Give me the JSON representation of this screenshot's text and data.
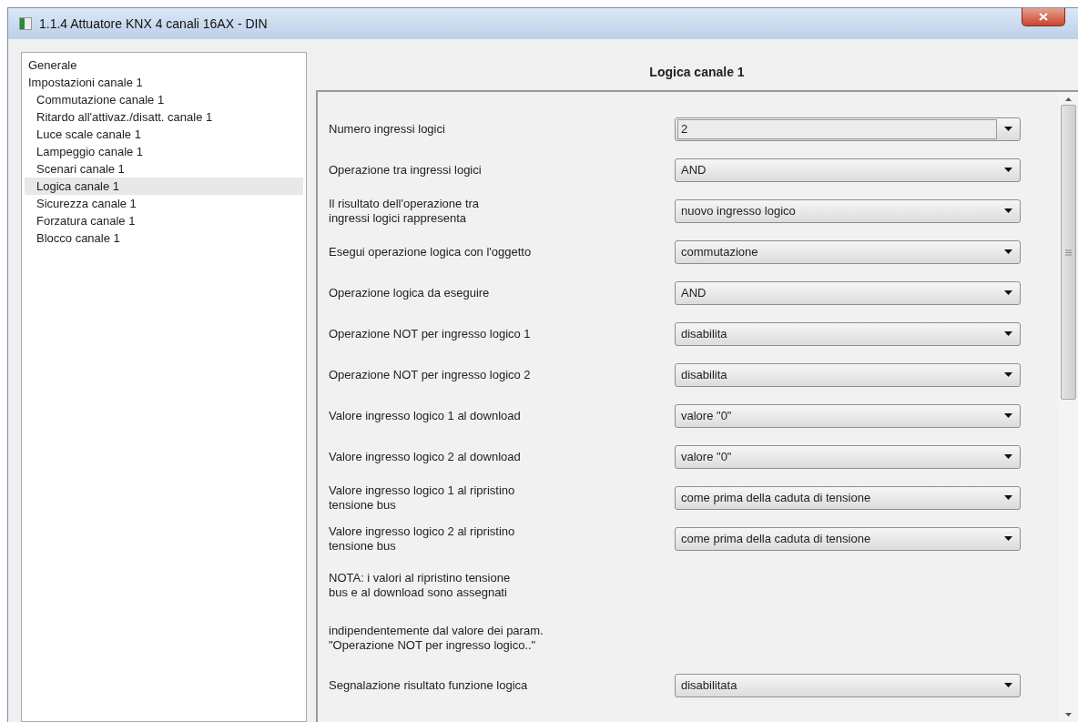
{
  "window": {
    "title": "1.1.4 Attuatore KNX 4 canali 16AX - DIN"
  },
  "sidebar": {
    "items": [
      {
        "label": "Generale",
        "selected": false
      },
      {
        "label": "Impostazioni canale 1",
        "selected": false,
        "children": [
          {
            "label": "Commutazione canale 1",
            "selected": false
          },
          {
            "label": "Ritardo all'attivaz./disatt. canale 1",
            "selected": false
          },
          {
            "label": "Luce scale canale 1",
            "selected": false
          },
          {
            "label": "Lampeggio canale 1",
            "selected": false
          },
          {
            "label": "Scenari canale 1",
            "selected": false
          },
          {
            "label": "Logica canale 1",
            "selected": true
          },
          {
            "label": "Sicurezza canale 1",
            "selected": false
          },
          {
            "label": "Forzatura canale 1",
            "selected": false
          },
          {
            "label": "Blocco canale 1",
            "selected": false
          }
        ]
      }
    ]
  },
  "panel": {
    "title": "Logica canale 1",
    "rows": [
      {
        "kind": "edit-dropdown",
        "label": "Numero ingressi logici",
        "value": "2"
      },
      {
        "kind": "dropdown",
        "label": "Operazione tra ingressi logici",
        "value": "AND"
      },
      {
        "kind": "dropdown",
        "label": "Il risultato dell'operazione tra\ningressi logici rappresenta",
        "value": "nuovo ingresso logico"
      },
      {
        "kind": "dropdown",
        "label": "Esegui operazione logica con l'oggetto",
        "value": "commutazione"
      },
      {
        "kind": "dropdown",
        "label": "Operazione logica da eseguire",
        "value": "AND"
      },
      {
        "kind": "dropdown",
        "label": "Operazione NOT per ingresso logico 1",
        "value": "disabilita"
      },
      {
        "kind": "dropdown",
        "label": "Operazione NOT per ingresso logico 2",
        "value": "disabilita"
      },
      {
        "kind": "dropdown",
        "label": "Valore ingresso logico 1 al download",
        "value": "valore \"0\""
      },
      {
        "kind": "dropdown",
        "label": "Valore ingresso logico 2 al download",
        "value": "valore \"0\""
      },
      {
        "kind": "dropdown",
        "label": "Valore ingresso logico 1 al ripristino\ntensione bus",
        "value": "come prima della caduta di tensione"
      },
      {
        "kind": "dropdown",
        "label": "Valore ingresso logico 2 al ripristino\ntensione bus",
        "value": "come prima della caduta di tensione"
      },
      {
        "kind": "note",
        "label": "NOTA: i valori al ripristino tensione\nbus e al download sono assegnati"
      },
      {
        "kind": "note",
        "label": "indipendentemente dal valore dei param.\n\"Operazione NOT per ingresso logico..\""
      },
      {
        "kind": "dropdown",
        "label": "Segnalazione risultato funzione logica",
        "value": "disabilitata"
      }
    ]
  }
}
